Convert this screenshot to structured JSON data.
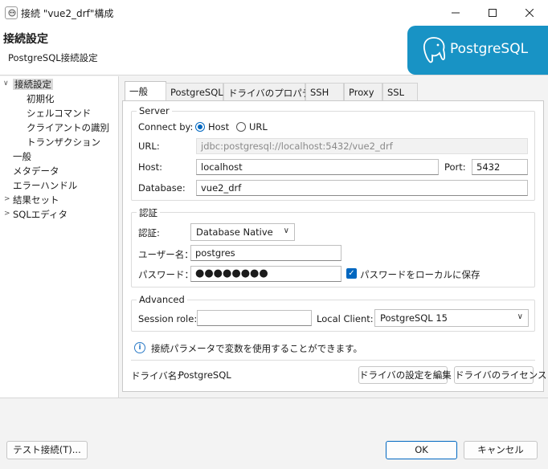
{
  "window": {
    "title": "接続 \"vue2_drf\"構成"
  },
  "header": {
    "title": "接続設定",
    "subtitle": "PostgreSQL接続設定",
    "logo_text": "PostgreSQL"
  },
  "tree": {
    "items": [
      {
        "label": "接続設定"
      },
      {
        "label": "初期化"
      },
      {
        "label": "シェルコマンド"
      },
      {
        "label": "クライアントの識別"
      },
      {
        "label": "トランザクション"
      },
      {
        "label": "一般"
      },
      {
        "label": "メタデータ"
      },
      {
        "label": "エラーハンドル"
      },
      {
        "label": "結果セット"
      },
      {
        "label": "SQLエディタ"
      }
    ]
  },
  "tabs": [
    "一般",
    "PostgreSQL",
    "ドライバのプロパティ",
    "SSH",
    "Proxy",
    "SSL"
  ],
  "server": {
    "legend": "Server",
    "connect_by_label": "Connect by:",
    "host_option": "Host",
    "url_option": "URL",
    "url_label": "URL:",
    "url_value": "jdbc:postgresql://localhost:5432/vue2_drf",
    "host_label": "Host:",
    "host_value": "localhost",
    "port_label": "Port:",
    "port_value": "5432",
    "database_label": "Database:",
    "database_value": "vue2_drf"
  },
  "auth": {
    "legend": "認証",
    "auth_label": "認証:",
    "auth_value": "Database Native",
    "user_label": "ユーザー名：",
    "user_value": "postgres",
    "password_label": "パスワード：",
    "password_value": "●●●●●●●●",
    "save_password_label": "パスワードをローカルに保存"
  },
  "advanced": {
    "legend": "Advanced",
    "session_role_label": "Session role:",
    "session_role_value": "",
    "local_client_label": "Local Client:",
    "local_client_value": "PostgreSQL 15"
  },
  "info_text": "接続パラメータで変数を使用することができます。",
  "driver": {
    "name_label": "ドライバ名:",
    "name_value": "PostgreSQL",
    "edit_button": "ドライバの設定を編集",
    "license_button": "ドライバのライセンス"
  },
  "footer": {
    "test_button": "テスト接続(T)...",
    "ok_button": "OK",
    "cancel_button": "キャンセル"
  },
  "colors": {
    "accent": "#0067c0",
    "logo_bg": "#1893c5"
  }
}
